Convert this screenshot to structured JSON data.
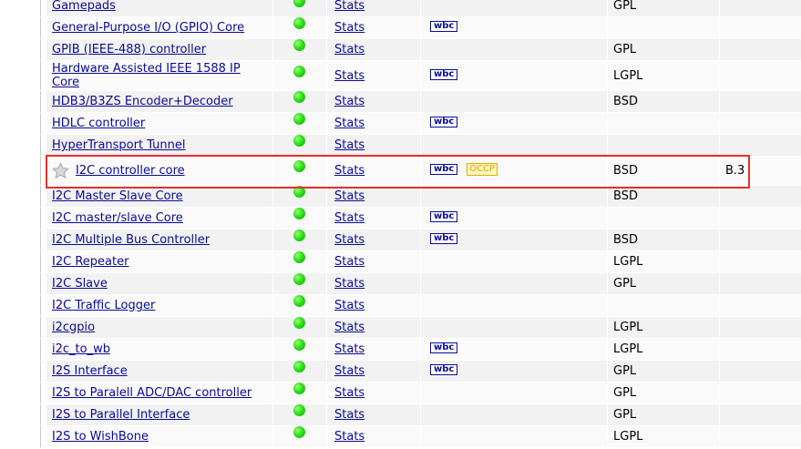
{
  "colors": {
    "link": "#0a0a9c",
    "highlight": "#e53030",
    "status_ok": "#2ee01a",
    "occp": "#e0a800"
  },
  "rows": [
    {
      "name": "Gamepads",
      "stats": "Stats",
      "wbc": "",
      "occp": "",
      "license": "GPL",
      "version": ""
    },
    {
      "name": "General-Purpose I/O (GPIO) Core",
      "stats": "Stats",
      "wbc": "wbc",
      "occp": "",
      "license": "",
      "version": ""
    },
    {
      "name": "GPIB (IEEE-488) controller",
      "stats": "Stats",
      "wbc": "",
      "occp": "",
      "license": "GPL",
      "version": ""
    },
    {
      "name": "Hardware Assisted IEEE 1588 IP Core",
      "stats": "Stats",
      "wbc": "wbc",
      "occp": "",
      "license": "LGPL",
      "version": ""
    },
    {
      "name": "HDB3/B3ZS Encoder+Decoder",
      "stats": "Stats",
      "wbc": "",
      "occp": "",
      "license": "BSD",
      "version": ""
    },
    {
      "name": "HDLC controller",
      "stats": "Stats",
      "wbc": "wbc",
      "occp": "",
      "license": "",
      "version": ""
    },
    {
      "name": "HyperTransport Tunnel",
      "stats": "Stats",
      "wbc": "",
      "occp": "",
      "license": "",
      "version": ""
    },
    {
      "name": "I2C controller core",
      "stats": "Stats",
      "wbc": "wbc",
      "occp": "OCCP",
      "license": "BSD",
      "version": "B.3"
    },
    {
      "name": "I2C Master Slave Core",
      "stats": "Stats",
      "wbc": "",
      "occp": "",
      "license": "BSD",
      "version": ""
    },
    {
      "name": "I2C master/slave Core",
      "stats": "Stats",
      "wbc": "wbc",
      "occp": "",
      "license": "",
      "version": ""
    },
    {
      "name": "I2C Multiple Bus Controller",
      "stats": "Stats",
      "wbc": "wbc",
      "occp": "",
      "license": "BSD",
      "version": ""
    },
    {
      "name": "I2C Repeater",
      "stats": "Stats",
      "wbc": "",
      "occp": "",
      "license": "LGPL",
      "version": ""
    },
    {
      "name": "I2C Slave",
      "stats": "Stats",
      "wbc": "",
      "occp": "",
      "license": "GPL",
      "version": ""
    },
    {
      "name": "I2C Traffic Logger",
      "stats": "Stats",
      "wbc": "",
      "occp": "",
      "license": "",
      "version": ""
    },
    {
      "name": "i2cgpio",
      "stats": "Stats",
      "wbc": "",
      "occp": "",
      "license": "LGPL",
      "version": ""
    },
    {
      "name": "i2c_to_wb",
      "stats": "Stats",
      "wbc": "wbc",
      "occp": "",
      "license": "LGPL",
      "version": ""
    },
    {
      "name": "I2S Interface",
      "stats": "Stats",
      "wbc": "wbc",
      "occp": "",
      "license": "GPL",
      "version": ""
    },
    {
      "name": "I2S to Paralell ADC/DAC controller",
      "stats": "Stats",
      "wbc": "",
      "occp": "",
      "license": "GPL",
      "version": ""
    },
    {
      "name": "I2S to Parallel Interface",
      "stats": "Stats",
      "wbc": "",
      "occp": "",
      "license": "GPL",
      "version": ""
    },
    {
      "name": "I2S to WishBone",
      "stats": "Stats",
      "wbc": "",
      "occp": "",
      "license": "LGPL",
      "version": ""
    }
  ]
}
